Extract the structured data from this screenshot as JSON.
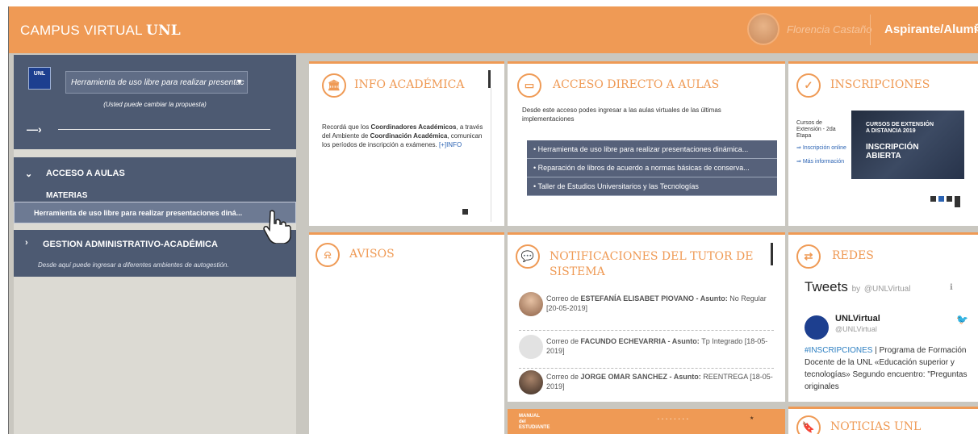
{
  "header": {
    "brand_prefix": "CAMPUS VIRTUAL ",
    "brand_bold": "UNL",
    "user_name": "Florencia Castaño",
    "role": "Aspirante/Alumno"
  },
  "sidebar": {
    "logo_text": "UNL",
    "proposal_select": "Herramienta de uso libre para realizar presentac",
    "proposal_note": "(Usted puede cambiar la propuesta)",
    "section_acceso": "ACCESO A AULAS",
    "sub_materias": "MATERIAS",
    "active_course": "Herramienta de uso libre para realizar presentaciones diná...",
    "section_gestion": "GESTION ADMINISTRATIVO-ACADÉMICA",
    "gestion_note": "Desde aquí puede ingresar a diferentes ambientes de autogestión."
  },
  "cards": {
    "info_academica": {
      "title": "INFO ACADÉMICA",
      "text_1": "Recordá que los ",
      "bold_1": "Coordinadores Académicos",
      "text_2": ", a través del Ambiente de ",
      "bold_2": "Coordinación Académica",
      "text_3": ", comunican los períodos de inscripción a exámenes. ",
      "link": "[+]INFO"
    },
    "acceso_directo": {
      "title": "ACCESO DIRECTO A AULAS",
      "intro": "Desde este acceso podes ingresar a las aulas virtuales de las últimas implementaciones",
      "items": [
        "Herramienta de uso libre para realizar presentaciones dinámica...",
        "Reparación de libros de acuerdo a normas básicas de conserva...",
        "Taller de Estudios Universitarios y las Tecnologías"
      ]
    },
    "inscripciones": {
      "title": "INSCRIPCIONES",
      "course": "Cursos de Extensión - 2da Etapa",
      "link_inscripcion": "Inscripción online",
      "link_mas": "Más información",
      "banner_line1": "CURSOS DE EXTENSIÓN",
      "banner_line2": "A DISTANCIA 2019",
      "banner_line3": "INSCRIPCIÓN",
      "banner_line4": "ABIERTA"
    },
    "avisos": {
      "title": "AVISOS"
    },
    "notificaciones": {
      "title": "NOTIFICACIONES DEL TUTOR DE SISTEMA",
      "messages": [
        {
          "prefix": "Correo de ",
          "sender": "ESTEFANÍA ELISABET PIOVANO",
          "asunto_label": " - Asunto: ",
          "asunto": "No Regular",
          "date": "[20-05-2019]"
        },
        {
          "prefix": "Correo de ",
          "sender": "FACUNDO ECHEVARRIA",
          "asunto_label": " - Asunto: ",
          "asunto": "Tp Integrado",
          "date": "[18-05-2019]"
        },
        {
          "prefix": "Correo de ",
          "sender": "JORGE OMAR SANCHEZ",
          "asunto_label": " - Asunto: ",
          "asunto": "REENTREGA",
          "date": "[18-05-2019]"
        }
      ]
    },
    "manual": {
      "title": "MANUAL del ESTUDIANTE"
    },
    "redes": {
      "title": "REDES",
      "tweets_label": "Tweets",
      "by_label": "by",
      "handle": "@UNLVirtual",
      "account_name": "UNLVirtual",
      "account_handle": "@UNLVirtual",
      "hashtag": "#INSCRIPCIONES",
      "tweet_text": " | Programa de Formación Docente de la UNL «Educación superior y tecnologías» Segundo encuentro: \"Preguntas originales"
    },
    "noticias": {
      "title": "NOTICIAS UNL"
    }
  },
  "colors": {
    "accent": "#ef9a55",
    "sidebar": "#4d5a72",
    "background": "#c9c7c0"
  }
}
